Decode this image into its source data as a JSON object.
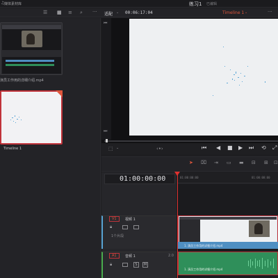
{
  "topbar": {
    "media_pool_title": "媒体素材库",
    "project_title": "练习1",
    "edited_label": "已编辑"
  },
  "toolbar": {
    "source_label": "适配",
    "timecode": "00:06:17:04",
    "timeline_name": "Timeline 1"
  },
  "media_pool": {
    "clips": [
      {
        "label": "演员工作用的详细介绍.mp4"
      },
      {
        "label": "Timeline 1"
      }
    ]
  },
  "timeline": {
    "timecode": "01:00:00:00",
    "ruler": [
      "01:00:00:00",
      "01:00:08:00"
    ],
    "tracks": [
      {
        "badge": "V1",
        "name": "视频 1",
        "clip_label": "1. 演员工作用的详细介绍.mp4",
        "sub": "1个片段"
      },
      {
        "badge": "A1",
        "name": "音频 1",
        "level": "2.0",
        "clip_label": "1. 演员工作用的详细介绍.mp4"
      }
    ]
  },
  "colors": {
    "accent": "#e0563c",
    "video_track": "#4f8fc2",
    "audio_track": "#2f8f5a",
    "playhead": "#e0312f"
  }
}
